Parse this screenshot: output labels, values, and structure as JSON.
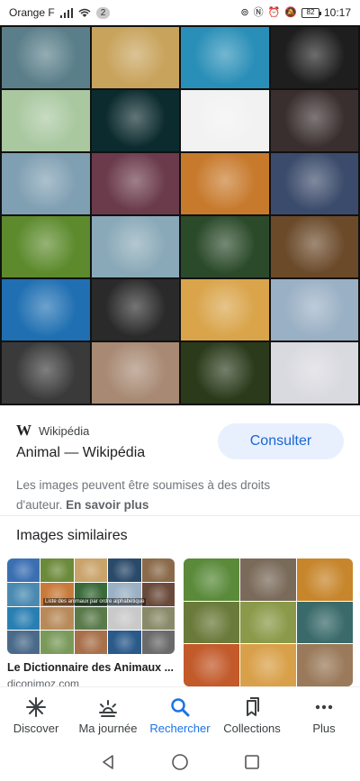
{
  "status_bar": {
    "carrier": "Orange F",
    "notification_count": "2",
    "battery": "82",
    "time": "10:17"
  },
  "collage": {
    "tiles": [
      {
        "icon": "crocodile",
        "color": "#5b7f8a"
      },
      {
        "icon": "starfish",
        "color": "#c8a35c"
      },
      {
        "icon": "coral-reef",
        "color": "#2a8fb8"
      },
      {
        "icon": "octopus",
        "color": "#1e1e1e"
      },
      {
        "icon": "dinosaurs",
        "color": "#a9c8a0"
      },
      {
        "icon": "jellyfish",
        "color": "#0c2b2e"
      },
      {
        "icon": "spotted-beetle",
        "color": "#f2f2f2"
      },
      {
        "icon": "sea-worm",
        "color": "#3a2f2f"
      },
      {
        "icon": "shell",
        "color": "#7f9fb2"
      },
      {
        "icon": "giant-clam",
        "color": "#6b3b4b"
      },
      {
        "icon": "tiger",
        "color": "#c77a2c"
      },
      {
        "icon": "sea-squirt",
        "color": "#3b4b6b"
      },
      {
        "icon": "ladybug",
        "color": "#5c8a2c"
      },
      {
        "icon": "tardigrade",
        "color": "#8aa9b8"
      },
      {
        "icon": "hydra",
        "color": "#2b4a2a"
      },
      {
        "icon": "moray-eel",
        "color": "#6b4a2a"
      },
      {
        "icon": "shark",
        "color": "#1f6fb2"
      },
      {
        "icon": "crab",
        "color": "#2a2a2a"
      },
      {
        "icon": "sponge",
        "color": "#d9a44a"
      },
      {
        "icon": "blue-jay",
        "color": "#9ab0c4"
      },
      {
        "icon": "bat",
        "color": "#3a3a3a"
      },
      {
        "icon": "jumping-spider",
        "color": "#a88a74"
      },
      {
        "icon": "flatworm",
        "color": "#2a3a1a"
      },
      {
        "icon": "sponge-figure",
        "color": "#d9d9e0"
      }
    ]
  },
  "result": {
    "source_name": "Wikipédia",
    "source_logo": "W",
    "title": "Animal — Wikipédia",
    "consult_button": "Consulter",
    "copyright_text": "Les images peuvent être soumises à des droits d'auteur.",
    "learn_more": "En savoir plus"
  },
  "similar": {
    "heading": "Images similaires",
    "cards": [
      {
        "title": "Le Dictionnaire des Animaux ...",
        "domain": "diconimoz.com",
        "overlay_text": "Liste des animaux par ordre alphabétique",
        "swatches": [
          "#3b6fb2",
          "#6b8a3a",
          "#c9a36a",
          "#2a4a6a",
          "#8a6a4a",
          "#4a8ab2",
          "#c77a3a",
          "#3a6a3a",
          "#9ab0c4",
          "#6a4a3a",
          "#2a7fb2",
          "#b88a5a",
          "#5a7a4a",
          "#c9c9c9",
          "#8a8a6a",
          "#4a6a8a",
          "#7a9a5a",
          "#a8704a",
          "#2a5a8a",
          "#6a6a6a"
        ]
      },
      {
        "title": "",
        "domain": "",
        "swatches": [
          "#5a8a3a",
          "#7a6a5a",
          "#c7862c",
          "#6a7a3a",
          "#8a9a4a",
          "#3a6a6a",
          "#c25a2a",
          "#d9a04a",
          "#9a7a5a"
        ]
      }
    ]
  },
  "bottom_nav": {
    "items": [
      {
        "label": "Discover",
        "icon": "sparkle-icon",
        "active": false
      },
      {
        "label": "Ma journée",
        "icon": "sunrise-icon",
        "active": false
      },
      {
        "label": "Rechercher",
        "icon": "search-icon",
        "active": true
      },
      {
        "label": "Collections",
        "icon": "bookmark-icon",
        "active": false
      },
      {
        "label": "Plus",
        "icon": "more-icon",
        "active": false
      }
    ]
  },
  "colors": {
    "accent": "#1a73e8",
    "consult_bg": "#e8f0fe",
    "consult_text": "#1967d2",
    "muted_text": "#70757a"
  }
}
